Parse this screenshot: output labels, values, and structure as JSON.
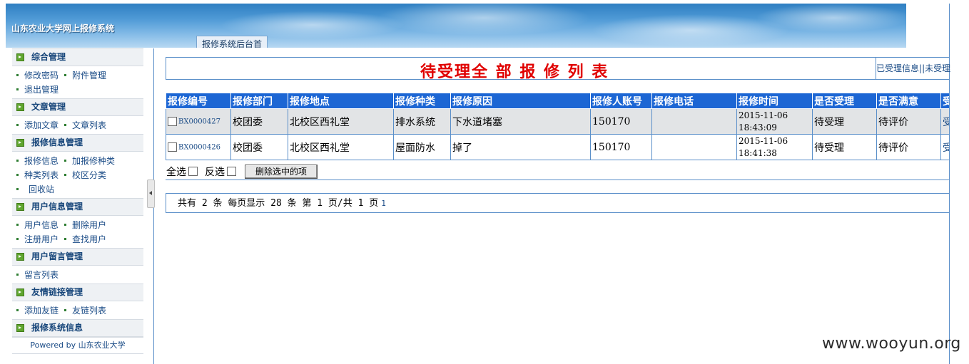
{
  "header": {
    "app_title": "山东农业大学网上报修系统",
    "tab_label": "报修系统后台首"
  },
  "sidebar": {
    "sections": [
      {
        "title": "综合管理",
        "rows": [
          [
            "修改密码",
            "附件管理"
          ],
          [
            "退出管理"
          ]
        ]
      },
      {
        "title": "文章管理",
        "rows": [
          [
            "添加文章",
            "文章列表"
          ]
        ]
      },
      {
        "title": "报修信息管理",
        "rows": [
          [
            "报修信息",
            "加报修种类"
          ],
          [
            "种类列表",
            "校区分类"
          ],
          [
            "回收站"
          ]
        ]
      },
      {
        "title": "用户信息管理",
        "rows": [
          [
            "用户信息",
            "删除用户"
          ],
          [
            "注册用户",
            "查找用户"
          ]
        ]
      },
      {
        "title": "用户留言管理",
        "rows": [
          [
            "留言列表"
          ]
        ]
      },
      {
        "title": "友情链接管理",
        "rows": [
          [
            "添加友链",
            "友链列表"
          ]
        ]
      },
      {
        "title": "报修系统信息",
        "rows": []
      }
    ],
    "powered": "Powered by 山东农业大学"
  },
  "main": {
    "title": "待受理全 部 报 修 列 表",
    "links": [
      "已受理信息",
      "|",
      "|未受理"
    ],
    "columns": [
      "报修编号",
      "报修部门",
      "报修地点",
      "报修种类",
      "报修原因",
      "报修人账号",
      "报修电话",
      "报修时间",
      "是否受理",
      "是否满意",
      "受"
    ],
    "rows": [
      {
        "id": "BX0000427",
        "dept": "校团委",
        "place": "北校区西礼堂",
        "type": "排水系统",
        "reason": "下水道堵塞",
        "account": "150170",
        "phone": "",
        "time": "2015-11-06 18:43:09",
        "accepted": "待受理",
        "satisfied": "待评价",
        "action": "受"
      },
      {
        "id": "BX0000426",
        "dept": "校团委",
        "place": "北校区西礼堂",
        "type": "屋面防水",
        "reason": "掉了",
        "account": "150170",
        "phone": "",
        "time": "2015-11-06 18:41:38",
        "accepted": "待受理",
        "satisfied": "待评价",
        "action": "受"
      }
    ],
    "select_all": "全选",
    "invert": "反选",
    "delete_btn": "删除选中的项",
    "pager_text": "共有  2 条 每页显示 28 条 第 1 页/共 1 页",
    "pager_link": "1"
  },
  "watermark": "www.wooyun.org"
}
